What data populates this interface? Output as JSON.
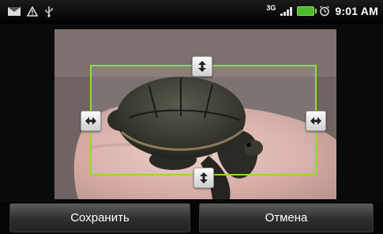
{
  "status_bar": {
    "icons_left": [
      "mail-icon",
      "warning-icon",
      "usb-icon"
    ],
    "network_type": "3G",
    "icons_right": [
      "signal-icon",
      "battery-icon",
      "alarm-icon"
    ],
    "time": "9:01 AM",
    "colors": {
      "battery": "#4cbb2c"
    }
  },
  "editor": {
    "image_subject": "turtle-photo",
    "crop_frame_color": "#8fdc2f",
    "handles": [
      "handle-top",
      "handle-bottom",
      "handle-left",
      "handle-right"
    ]
  },
  "buttons": {
    "save_label": "Сохранить",
    "cancel_label": "Отмена"
  }
}
